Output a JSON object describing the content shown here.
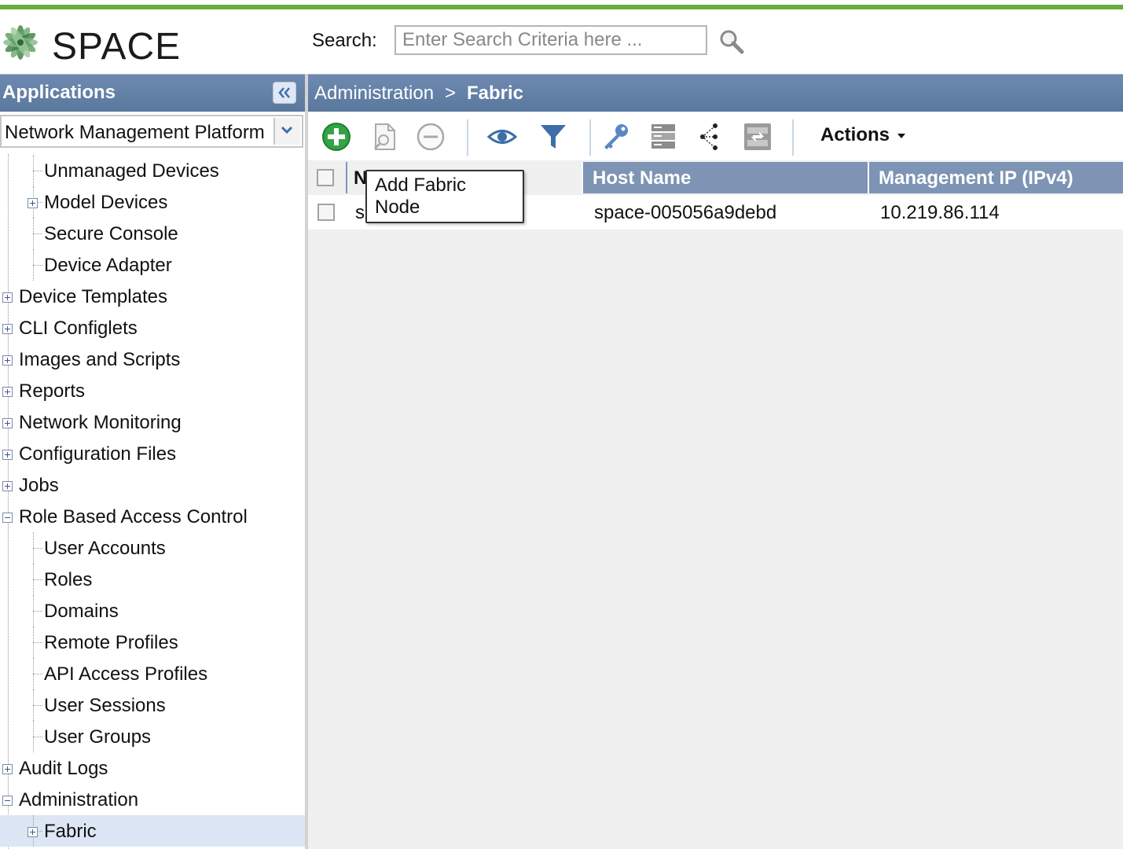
{
  "brand": {
    "name": "SPACE"
  },
  "search": {
    "label": "Search:",
    "placeholder": "Enter Search Criteria here ..."
  },
  "left_panel": {
    "title": "Applications",
    "app_selector": "Network Management Platform",
    "tree": [
      {
        "label": "Unmanaged Devices",
        "level": 1,
        "expander": "none"
      },
      {
        "label": "Model Devices",
        "level": 1,
        "expander": "plus"
      },
      {
        "label": "Secure Console",
        "level": 1,
        "expander": "none"
      },
      {
        "label": "Device Adapter",
        "level": 1,
        "expander": "none"
      },
      {
        "label": "Device Templates",
        "level": 0,
        "expander": "plus"
      },
      {
        "label": "CLI Configlets",
        "level": 0,
        "expander": "plus"
      },
      {
        "label": "Images and Scripts",
        "level": 0,
        "expander": "plus"
      },
      {
        "label": "Reports",
        "level": 0,
        "expander": "plus"
      },
      {
        "label": "Network Monitoring",
        "level": 0,
        "expander": "plus"
      },
      {
        "label": "Configuration Files",
        "level": 0,
        "expander": "plus"
      },
      {
        "label": "Jobs",
        "level": 0,
        "expander": "plus"
      },
      {
        "label": "Role Based Access Control",
        "level": 0,
        "expander": "minus"
      },
      {
        "label": "User Accounts",
        "level": 1,
        "expander": "none"
      },
      {
        "label": "Roles",
        "level": 1,
        "expander": "none"
      },
      {
        "label": "Domains",
        "level": 1,
        "expander": "none"
      },
      {
        "label": "Remote Profiles",
        "level": 1,
        "expander": "none"
      },
      {
        "label": "API Access Profiles",
        "level": 1,
        "expander": "none"
      },
      {
        "label": "User Sessions",
        "level": 1,
        "expander": "none"
      },
      {
        "label": "User Groups",
        "level": 1,
        "expander": "none"
      },
      {
        "label": "Audit Logs",
        "level": 0,
        "expander": "plus"
      },
      {
        "label": "Administration",
        "level": 0,
        "expander": "minus"
      },
      {
        "label": "Fabric",
        "level": 1,
        "expander": "plus",
        "selected": true
      }
    ]
  },
  "breadcrumb": {
    "parent": "Administration",
    "separator": ">",
    "current": "Fabric"
  },
  "toolbar": {
    "icons": [
      "add-icon",
      "modify-icon",
      "delete-icon",
      "view-icon",
      "filter-icon",
      "key-icon",
      "server-rack-icon",
      "topology-icon",
      "sync-icon"
    ],
    "actions_label": "Actions"
  },
  "grid": {
    "columns": [
      "N",
      "Host Name",
      "Management IP (IPv4)"
    ],
    "rows": [
      {
        "name": "s",
        "host_name": "space-005056a9debd",
        "management_ip": "10.219.86.114"
      }
    ]
  },
  "tooltip": {
    "line1": "Add Fabric",
    "line2": "Node"
  },
  "colors": {
    "accent_green": "#6aad3e",
    "header_blue": "#5a779d",
    "column_blue": "#7d94b4",
    "selection": "#dce6f5"
  }
}
